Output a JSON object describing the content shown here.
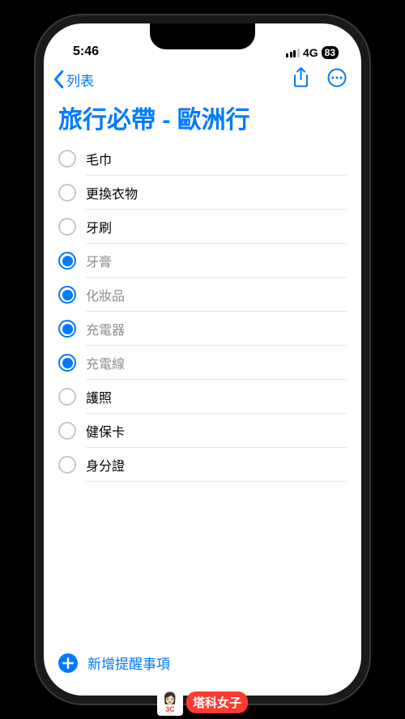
{
  "status": {
    "time": "5:46",
    "network": "4G",
    "battery": "83"
  },
  "nav": {
    "back_label": "列表"
  },
  "title": "旅行必帶 - 歐洲行",
  "items": [
    {
      "label": "毛巾",
      "checked": false
    },
    {
      "label": "更換衣物",
      "checked": false
    },
    {
      "label": "牙刷",
      "checked": false
    },
    {
      "label": "牙膏",
      "checked": true
    },
    {
      "label": "化妝品",
      "checked": true
    },
    {
      "label": "充電器",
      "checked": true
    },
    {
      "label": "充電線",
      "checked": true
    },
    {
      "label": "護照",
      "checked": false
    },
    {
      "label": "健保卡",
      "checked": false
    },
    {
      "label": "身分證",
      "checked": false
    }
  ],
  "bottom": {
    "add_label": "新增提醒事項"
  },
  "watermark": {
    "text": "塔科女子",
    "badge": "3C"
  }
}
